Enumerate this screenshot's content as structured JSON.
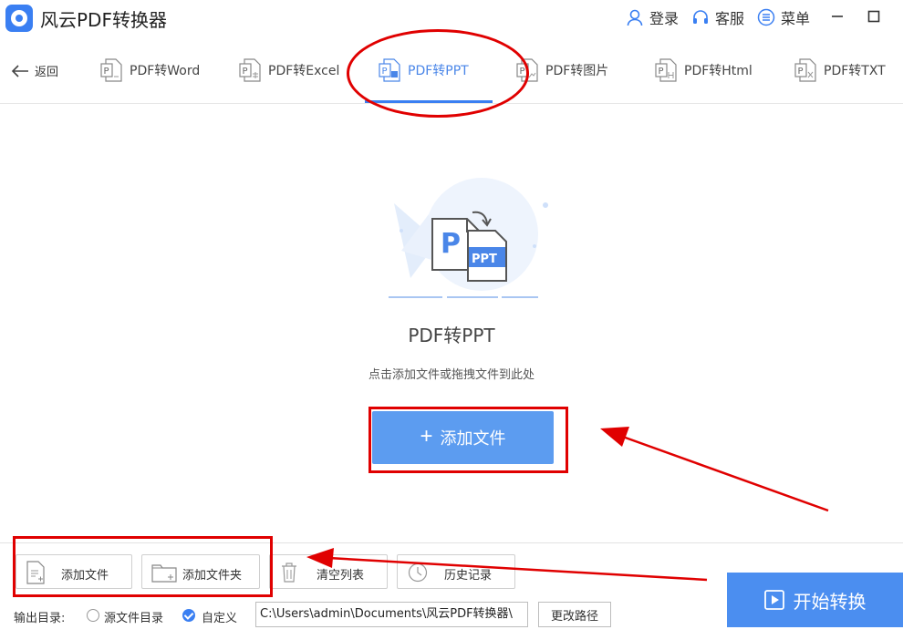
{
  "app": {
    "title": "风云PDF转换器",
    "actions": {
      "login": "登录",
      "service": "客服",
      "menu": "菜单"
    }
  },
  "nav": {
    "back_label": "返回",
    "tabs": [
      {
        "label": "PDF转Word",
        "icon": "pdf-word-icon"
      },
      {
        "label": "PDF转Excel",
        "icon": "pdf-excel-icon"
      },
      {
        "label": "PDF转PPT",
        "icon": "pdf-ppt-icon",
        "active": true
      },
      {
        "label": "PDF转图片",
        "icon": "pdf-image-icon"
      },
      {
        "label": "PDF转Html",
        "icon": "pdf-html-icon"
      },
      {
        "label": "PDF转TXT",
        "icon": "pdf-txt-icon"
      }
    ]
  },
  "main": {
    "illustration_letters": {
      "left": "P",
      "right": "PPT"
    },
    "title": "PDF转PPT",
    "subtitle": "点击添加文件或拖拽文件到此处",
    "add_button": "添加文件"
  },
  "toolbar": {
    "add_file": "添加文件",
    "add_folder": "添加文件夹",
    "clear_list": "清空列表",
    "history": "历史记录"
  },
  "output": {
    "label": "输出目录:",
    "option_source": "源文件目录",
    "option_custom": "自定义",
    "selected": "custom",
    "path": "C:\\Users\\admin\\Documents\\风云PDF转换器\\",
    "change_path": "更改路径"
  },
  "start_button": "开始转换",
  "colors": {
    "accent": "#3a7ff2",
    "button": "#5c9cf0",
    "annotation": "#e00000"
  }
}
